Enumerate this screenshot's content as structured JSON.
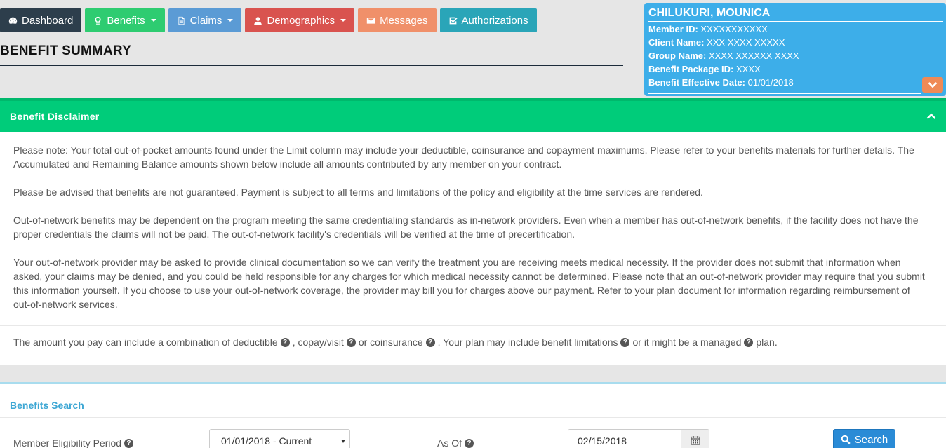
{
  "nav": {
    "dashboard": "Dashboard",
    "benefits": "Benefits",
    "claims": "Claims",
    "demographics": "Demographics",
    "messages": "Messages",
    "authorizations": "Authorizations"
  },
  "colors": {
    "dashboard": "#2d3e4c",
    "benefits": "#2ecc71",
    "claims": "#5b9bd5",
    "demographics": "#d9534f",
    "messages": "#f0906a",
    "authorizations": "#2aa5b8",
    "member_card": "#3daee9",
    "disclaimer_header": "#00cc7a",
    "search_button": "#2a8bd6"
  },
  "page": {
    "title": "BENEFIT SUMMARY"
  },
  "member": {
    "name": "CHILUKURI, MOUNICA",
    "member_id_label": "Member ID:",
    "member_id": "XXXXXXXXXXX",
    "client_name_label": "Client Name:",
    "client_name": "XXX XXXX XXXXX",
    "group_name_label": "Group Name:",
    "group_name": "XXXX XXXXXX XXXX",
    "benefit_package_label": "Benefit Package ID:",
    "benefit_package": "XXXX",
    "effective_date_label": "Benefit Effective Date:",
    "effective_date": "01/01/2018"
  },
  "disclaimer": {
    "title": "Benefit Disclaimer",
    "paragraphs": [
      "Please note: Your total out-of-pocket amounts found under the Limit column may include your deductible, coinsurance and copayment maximums. Please refer to your benefits materials for further details. The Accumulated and Remaining Balance amounts shown below include all amounts contributed by any member on your contract.",
      "Please be advised that benefits are not guaranteed. Payment is subject to all terms and limitations of the policy and eligibility at the time services are rendered.",
      "Out-of-network benefits may be dependent on the program meeting the same credentialing standards as in-network providers. Even when a member has out-of-network benefits, if the facility does not have the proper credentials the claims will not be paid. The out-of-network facility's credentials will be verified at the time of precertification.",
      "Your out-of-network provider may be asked to provide clinical documentation so we can verify the treatment you are receiving meets medical necessity. If the provider does not submit that information when asked, your claims may be denied, and you could be held responsible for any charges for which medical necessity cannot be determined. Please note that an out-of-network provider may require that you submit this information yourself. If you choose to use your out-of-network coverage, the provider may bill you for charges above our payment. Refer to your plan document for information regarding reimbursement of out-of-network services."
    ],
    "amount": {
      "part1": "The amount you pay can include a combination of deductible",
      "part2": ", copay/visit",
      "part3": "or coinsurance",
      "part4": ". Your plan may include benefit limitations",
      "part5": "or it might be a managed",
      "part6": "plan."
    }
  },
  "search": {
    "title": "Benefits Search",
    "eligibility_label": "Member Eligibility Period",
    "eligibility_value": "01/01/2018 - Current",
    "as_of_label": "As Of",
    "as_of_value": "02/15/2018",
    "search_label": "Search"
  }
}
